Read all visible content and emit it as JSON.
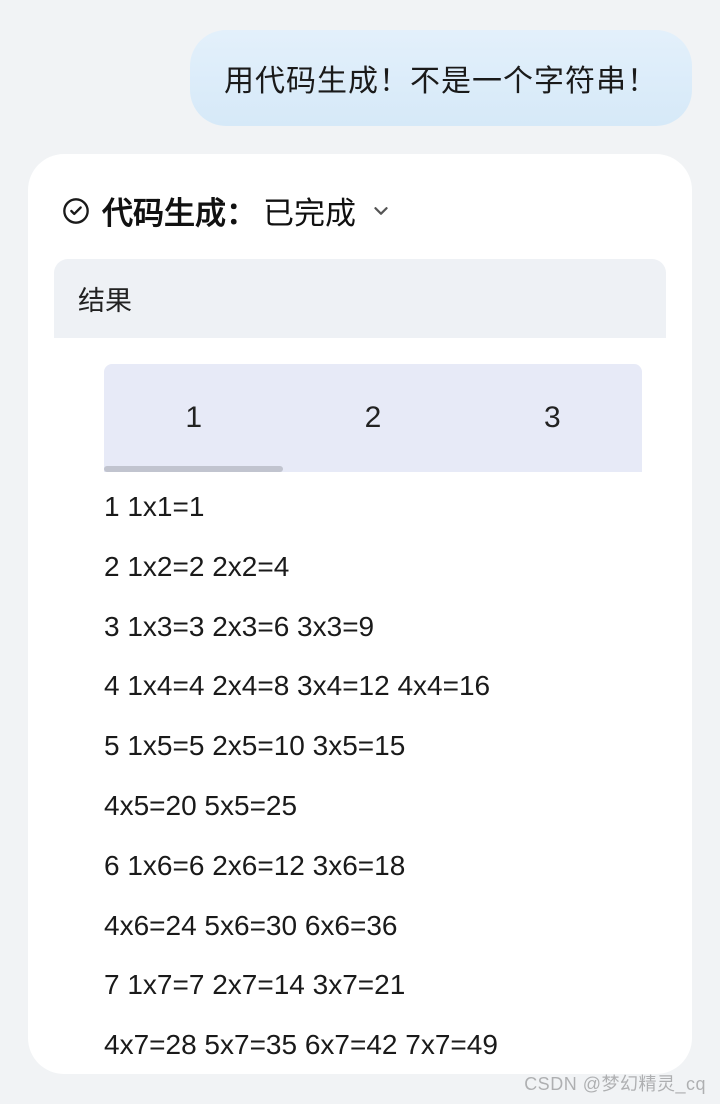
{
  "user_message": "用代码生成！不是一个字符串！",
  "status": {
    "prefix": "代码生成：",
    "state": "已完成"
  },
  "result": {
    "header": "结果",
    "tabs": [
      "1",
      "2",
      "3"
    ],
    "rows": [
      "1 1x1=1",
      "2 1x2=2 2x2=4",
      "3 1x3=3 2x3=6 3x3=9",
      "4 1x4=4 2x4=8 3x4=12 4x4=16",
      "5 1x5=5 2x5=10 3x5=15",
      "4x5=20 5x5=25",
      "6 1x6=6 2x6=12 3x6=18",
      "4x6=24 5x6=30 6x6=36",
      "7 1x7=7 2x7=14 3x7=21",
      "4x7=28 5x7=35 6x7=42 7x7=49"
    ]
  },
  "watermark": "CSDN @梦幻精灵_cq"
}
